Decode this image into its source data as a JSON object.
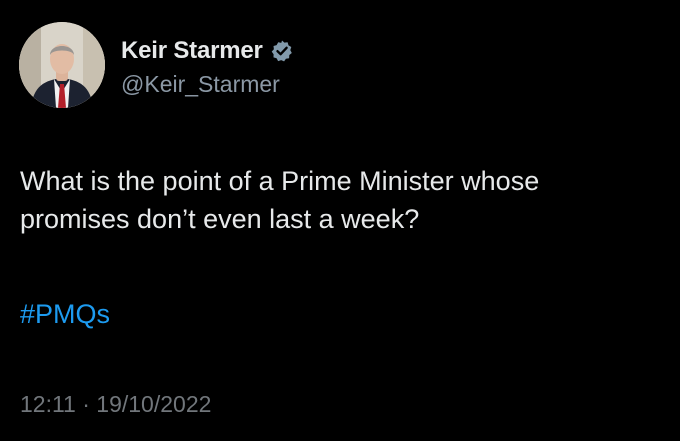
{
  "author": {
    "display_name": "Keir Starmer",
    "handle": "@Keir_Starmer",
    "verified_icon": "verified-badge-icon",
    "avatar_icon": "profile-photo"
  },
  "tweet": {
    "line1": "What is the point of a Prime Minister whose",
    "line2": "promises don’t even last a week?",
    "hashtag": "#PMQs",
    "timestamp": "12:11 · 19/10/2022"
  },
  "colors": {
    "background": "#000000",
    "text": "#e7e9ea",
    "secondary_text": "#8b98a5",
    "hashtag": "#1d9bf0",
    "verified_badge": "#829aab"
  }
}
